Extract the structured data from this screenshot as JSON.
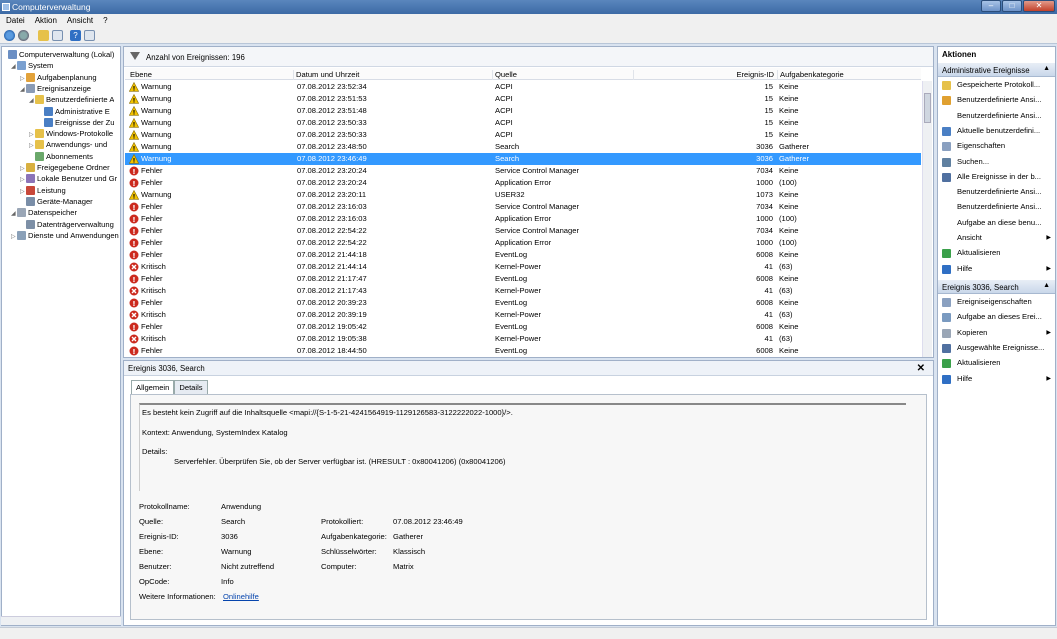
{
  "window": {
    "title": "Computerverwaltung"
  },
  "menu": [
    "Datei",
    "Aktion",
    "Ansicht",
    "?"
  ],
  "tree": [
    {
      "label": "Computerverwaltung (Lokal)",
      "level": 0,
      "icon": "computer-icon",
      "exp": ""
    },
    {
      "label": "System",
      "level": 1,
      "icon": "system-icon",
      "exp": "◢"
    },
    {
      "label": "Aufgabenplanung",
      "level": 2,
      "icon": "clock-icon",
      "exp": "▷"
    },
    {
      "label": "Ereignisanzeige",
      "level": 2,
      "icon": "event-viewer-icon",
      "exp": "◢"
    },
    {
      "label": "Benutzerdefinierte A",
      "level": 3,
      "icon": "folder-icon",
      "exp": "◢"
    },
    {
      "label": "Administrative E",
      "level": 4,
      "icon": "filter-icon",
      "exp": ""
    },
    {
      "label": "Ereignisse der Zu",
      "level": 4,
      "icon": "filter-icon",
      "exp": ""
    },
    {
      "label": "Windows-Protokolle",
      "level": 3,
      "icon": "folder-icon",
      "exp": "▷"
    },
    {
      "label": "Anwendungs- und",
      "level": 3,
      "icon": "folder-icon",
      "exp": "▷"
    },
    {
      "label": "Abonnements",
      "level": 3,
      "icon": "subscription-icon",
      "exp": ""
    },
    {
      "label": "Freigegebene Ordner",
      "level": 2,
      "icon": "shared-folder-icon",
      "exp": "▷"
    },
    {
      "label": "Lokale Benutzer und Gr",
      "level": 2,
      "icon": "users-icon",
      "exp": "▷"
    },
    {
      "label": "Leistung",
      "level": 2,
      "icon": "performance-icon",
      "exp": "▷"
    },
    {
      "label": "Geräte-Manager",
      "level": 2,
      "icon": "device-icon",
      "exp": ""
    },
    {
      "label": "Datenspeicher",
      "level": 1,
      "icon": "storage-icon",
      "exp": "◢"
    },
    {
      "label": "Datenträgerverwaltung",
      "level": 2,
      "icon": "disk-icon",
      "exp": ""
    },
    {
      "label": "Dienste und Anwendungen",
      "level": 1,
      "icon": "services-icon",
      "exp": "▷"
    }
  ],
  "list": {
    "count_label": "Anzahl von Ereignissen: 196",
    "columns": [
      "Ebene",
      "Datum und Uhrzeit",
      "Quelle",
      "Ereignis-ID",
      "Aufgabenkategorie"
    ],
    "rows": [
      {
        "level": "Warnung",
        "type": "warning",
        "date": "07.08.2012 23:52:34",
        "source": "ACPI",
        "id": "15",
        "category": "Keine"
      },
      {
        "level": "Warnung",
        "type": "warning",
        "date": "07.08.2012 23:51:53",
        "source": "ACPI",
        "id": "15",
        "category": "Keine"
      },
      {
        "level": "Warnung",
        "type": "warning",
        "date": "07.08.2012 23:51:48",
        "source": "ACPI",
        "id": "15",
        "category": "Keine"
      },
      {
        "level": "Warnung",
        "type": "warning",
        "date": "07.08.2012 23:50:33",
        "source": "ACPI",
        "id": "15",
        "category": "Keine"
      },
      {
        "level": "Warnung",
        "type": "warning",
        "date": "07.08.2012 23:50:33",
        "source": "ACPI",
        "id": "15",
        "category": "Keine"
      },
      {
        "level": "Warnung",
        "type": "warning",
        "date": "07.08.2012 23:48:50",
        "source": "Search",
        "id": "3036",
        "category": "Gatherer"
      },
      {
        "level": "Warnung",
        "type": "warning",
        "date": "07.08.2012 23:46:49",
        "source": "Search",
        "id": "3036",
        "category": "Gatherer",
        "selected": true
      },
      {
        "level": "Fehler",
        "type": "error",
        "date": "07.08.2012 23:20:24",
        "source": "Service Control Manager",
        "id": "7034",
        "category": "Keine"
      },
      {
        "level": "Fehler",
        "type": "error",
        "date": "07.08.2012 23:20:24",
        "source": "Application Error",
        "id": "1000",
        "category": "(100)"
      },
      {
        "level": "Warnung",
        "type": "warning",
        "date": "07.08.2012 23:20:11",
        "source": "USER32",
        "id": "1073",
        "category": "Keine"
      },
      {
        "level": "Fehler",
        "type": "error",
        "date": "07.08.2012 23:16:03",
        "source": "Service Control Manager",
        "id": "7034",
        "category": "Keine"
      },
      {
        "level": "Fehler",
        "type": "error",
        "date": "07.08.2012 23:16:03",
        "source": "Application Error",
        "id": "1000",
        "category": "(100)"
      },
      {
        "level": "Fehler",
        "type": "error",
        "date": "07.08.2012 22:54:22",
        "source": "Service Control Manager",
        "id": "7034",
        "category": "Keine"
      },
      {
        "level": "Fehler",
        "type": "error",
        "date": "07.08.2012 22:54:22",
        "source": "Application Error",
        "id": "1000",
        "category": "(100)"
      },
      {
        "level": "Fehler",
        "type": "error",
        "date": "07.08.2012 21:44:18",
        "source": "EventLog",
        "id": "6008",
        "category": "Keine"
      },
      {
        "level": "Kritisch",
        "type": "critical",
        "date": "07.08.2012 21:44:14",
        "source": "Kernel-Power",
        "id": "41",
        "category": "(63)"
      },
      {
        "level": "Fehler",
        "type": "error",
        "date": "07.08.2012 21:17:47",
        "source": "EventLog",
        "id": "6008",
        "category": "Keine"
      },
      {
        "level": "Kritisch",
        "type": "critical",
        "date": "07.08.2012 21:17:43",
        "source": "Kernel-Power",
        "id": "41",
        "category": "(63)"
      },
      {
        "level": "Fehler",
        "type": "error",
        "date": "07.08.2012 20:39:23",
        "source": "EventLog",
        "id": "6008",
        "category": "Keine"
      },
      {
        "level": "Kritisch",
        "type": "critical",
        "date": "07.08.2012 20:39:19",
        "source": "Kernel-Power",
        "id": "41",
        "category": "(63)"
      },
      {
        "level": "Fehler",
        "type": "error",
        "date": "07.08.2012 19:05:42",
        "source": "EventLog",
        "id": "6008",
        "category": "Keine"
      },
      {
        "level": "Kritisch",
        "type": "critical",
        "date": "07.08.2012 19:05:38",
        "source": "Kernel-Power",
        "id": "41",
        "category": "(63)"
      },
      {
        "level": "Fehler",
        "type": "error",
        "date": "07.08.2012 18:44:50",
        "source": "EventLog",
        "id": "6008",
        "category": "Keine"
      }
    ]
  },
  "detail": {
    "title": "Ereignis 3036, Search",
    "tabs": [
      "Allgemein",
      "Details"
    ],
    "message": {
      "line1": "Es besteht kein Zugriff auf die Inhaltsquelle <mapi://{S-1-5-21-4241564919-1129126583-3122222022-1000}/>.",
      "line2": "Kontext:  Anwendung, SystemIndex Katalog",
      "line3": "Details:",
      "line4": "Serverfehler. Überprüfen Sie, ob der Server verfügbar ist.  (HRESULT : 0x80041206) (0x80041206)"
    },
    "props": {
      "protokollname_label": "Protokollname:",
      "protokollname": "Anwendung",
      "quelle_label": "Quelle:",
      "quelle": "Search",
      "protokolliert_label": "Protokolliert:",
      "protokolliert": "07.08.2012 23:46:49",
      "ereignisid_label": "Ereignis-ID:",
      "ereignisid": "3036",
      "aufgabenkategorie_label": "Aufgabenkategorie:",
      "aufgabenkategorie": "Gatherer",
      "ebene_label": "Ebene:",
      "ebene": "Warnung",
      "schluessel_label": "Schlüsselwörter:",
      "schluessel": "Klassisch",
      "benutzer_label": "Benutzer:",
      "benutzer": "Nicht zutreffend",
      "computer_label": "Computer:",
      "computer": "Matrix",
      "opcode_label": "OpCode:",
      "opcode": "Info",
      "weitere_label": "Weitere Informationen:",
      "weitere_link": "Onlinehilfe"
    }
  },
  "actions": {
    "title": "Aktionen",
    "section1": "Administrative Ereignisse",
    "items1": [
      {
        "label": "Gespeicherte Protokoll...",
        "icon": "folder-open-icon",
        "arrow": false
      },
      {
        "label": "Benutzerdefinierte Ansi...",
        "icon": "filter-add-icon",
        "arrow": false
      },
      {
        "label": "Benutzerdefinierte Ansi...",
        "icon": "",
        "arrow": false
      },
      {
        "label": "Aktuelle benutzerdefini...",
        "icon": "filter-icon",
        "arrow": false
      },
      {
        "label": "Eigenschaften",
        "icon": "properties-icon",
        "arrow": false
      },
      {
        "label": "Suchen...",
        "icon": "find-icon",
        "arrow": false
      },
      {
        "label": "Alle Ereignisse in der b...",
        "icon": "save-icon",
        "arrow": false
      },
      {
        "label": "Benutzerdefinierte Ansi...",
        "icon": "",
        "arrow": false
      },
      {
        "label": "Benutzerdefinierte Ansi...",
        "icon": "",
        "arrow": false
      },
      {
        "label": "Aufgabe an diese benu...",
        "icon": "",
        "arrow": false
      },
      {
        "label": "Ansicht",
        "icon": "",
        "arrow": true
      },
      {
        "label": "Aktualisieren",
        "icon": "refresh-icon",
        "arrow": false
      },
      {
        "label": "Hilfe",
        "icon": "help-icon",
        "arrow": true
      }
    ],
    "section2": "Ereignis 3036, Search",
    "items2": [
      {
        "label": "Ereigniseigenschaften",
        "icon": "properties-icon",
        "arrow": false
      },
      {
        "label": "Aufgabe an dieses Erei...",
        "icon": "task-icon",
        "arrow": false
      },
      {
        "label": "Kopieren",
        "icon": "copy-icon",
        "arrow": true
      },
      {
        "label": "Ausgewählte Ereignisse...",
        "icon": "save-icon",
        "arrow": false
      },
      {
        "label": "Aktualisieren",
        "icon": "refresh-icon",
        "arrow": false
      },
      {
        "label": "Hilfe",
        "icon": "help-icon",
        "arrow": true
      }
    ]
  },
  "colors": {
    "selection": "#3399ff",
    "warning": "#f2c200",
    "error": "#cc2a1e",
    "header_blue": "#1f4e8c"
  }
}
